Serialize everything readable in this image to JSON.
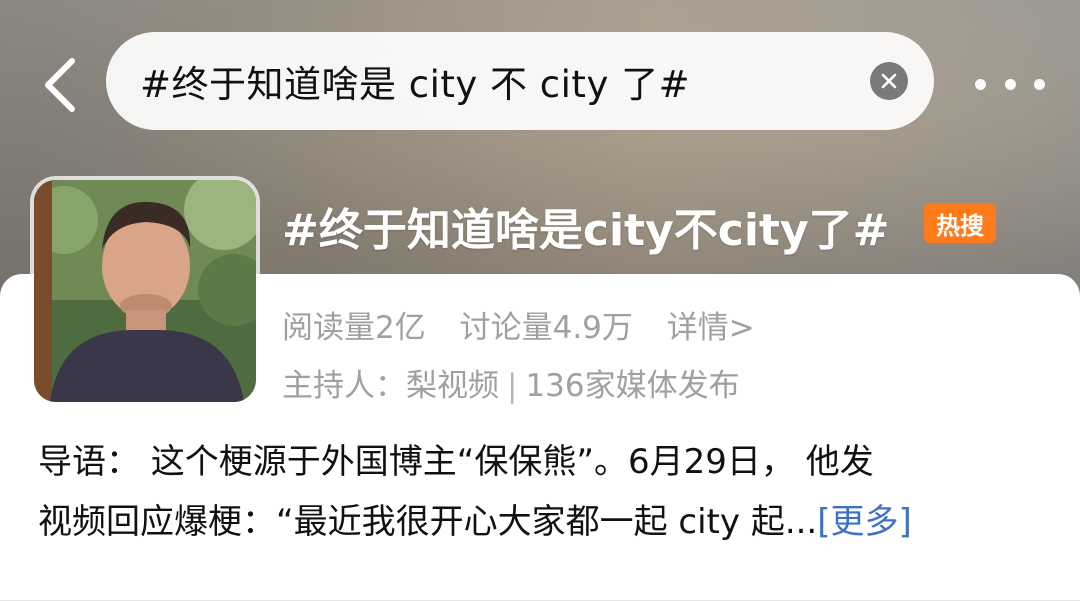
{
  "search": {
    "query": "#终于知道啥是 city 不 city 了#"
  },
  "topic": {
    "title": "#终于知道啥是city不city了#",
    "badge": "热搜",
    "read_count": "阅读量2亿",
    "discussion_count": "讨论量4.9万",
    "details_link": "详情>",
    "host_label": "主持人：",
    "host_name": "梨视频",
    "host_sep": "|",
    "media_count": "136家媒体发布"
  },
  "intro": {
    "line1": "导语：  这个梗源于外国博主“保保熊”。6月29日，  他发",
    "line2": "视频回应爆梗：“最近我很开心大家都一起 city 起...",
    "more": "[更多]"
  },
  "colors": {
    "badge": "#ff7a18",
    "link": "#3e72c6",
    "meta": "#a0a0a0"
  },
  "icons": {
    "back": "chevron-left-icon",
    "clear": "close-circle-icon",
    "more": "more-horizontal-icon"
  }
}
